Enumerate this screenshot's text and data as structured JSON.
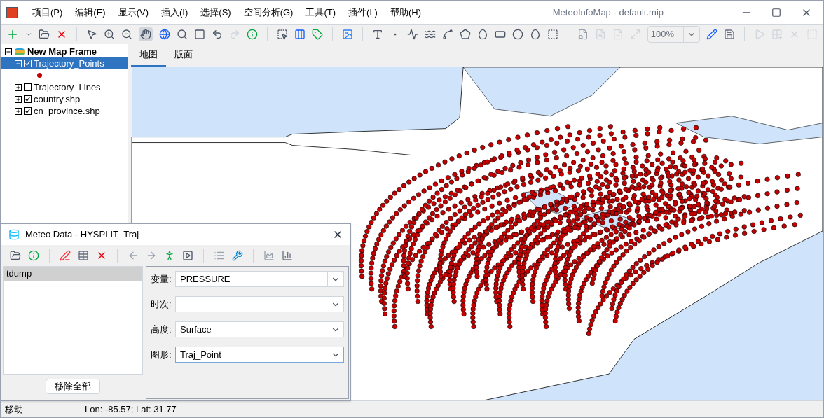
{
  "window": {
    "title": "MeteoInfoMap - default.mip"
  },
  "menu": [
    "项目(P)",
    "编辑(E)",
    "显示(V)",
    "插入(I)",
    "选择(S)",
    "空间分析(G)",
    "工具(T)",
    "插件(L)",
    "帮助(H)"
  ],
  "toolbar": {
    "zoom": "100%"
  },
  "layers": {
    "label": "New Map Frame",
    "expanded": true,
    "children": [
      {
        "label": "Trajectory_Points",
        "checked": true,
        "expanded": true,
        "selected": true
      },
      {
        "label": "Trajectory_Lines",
        "checked": false,
        "expanded": false,
        "selected": false
      },
      {
        "label": "country.shp",
        "checked": true,
        "expanded": false,
        "selected": false
      },
      {
        "label": "cn_province.shp",
        "checked": true,
        "expanded": false,
        "selected": false
      }
    ]
  },
  "tabs": [
    {
      "label": "地图",
      "selected": true
    },
    {
      "label": "版面",
      "selected": false
    }
  ],
  "dialog": {
    "title": "Meteo Data - HYSPLIT_Traj",
    "files": [
      {
        "label": "tdump",
        "selected": true
      }
    ],
    "remove_button": "移除全部",
    "fields": [
      {
        "label": "变量:",
        "value": "PRESSURE",
        "focused": false
      },
      {
        "label": "时次:",
        "focused": false
      },
      {
        "label": "高度:",
        "value": "Surface",
        "focused": false
      },
      {
        "label": "图形:",
        "value": "Traj_Point",
        "focused": true
      }
    ]
  },
  "status_bar": {
    "mode": "移动",
    "coords": "Lon: -85.57; Lat: 31.77"
  }
}
